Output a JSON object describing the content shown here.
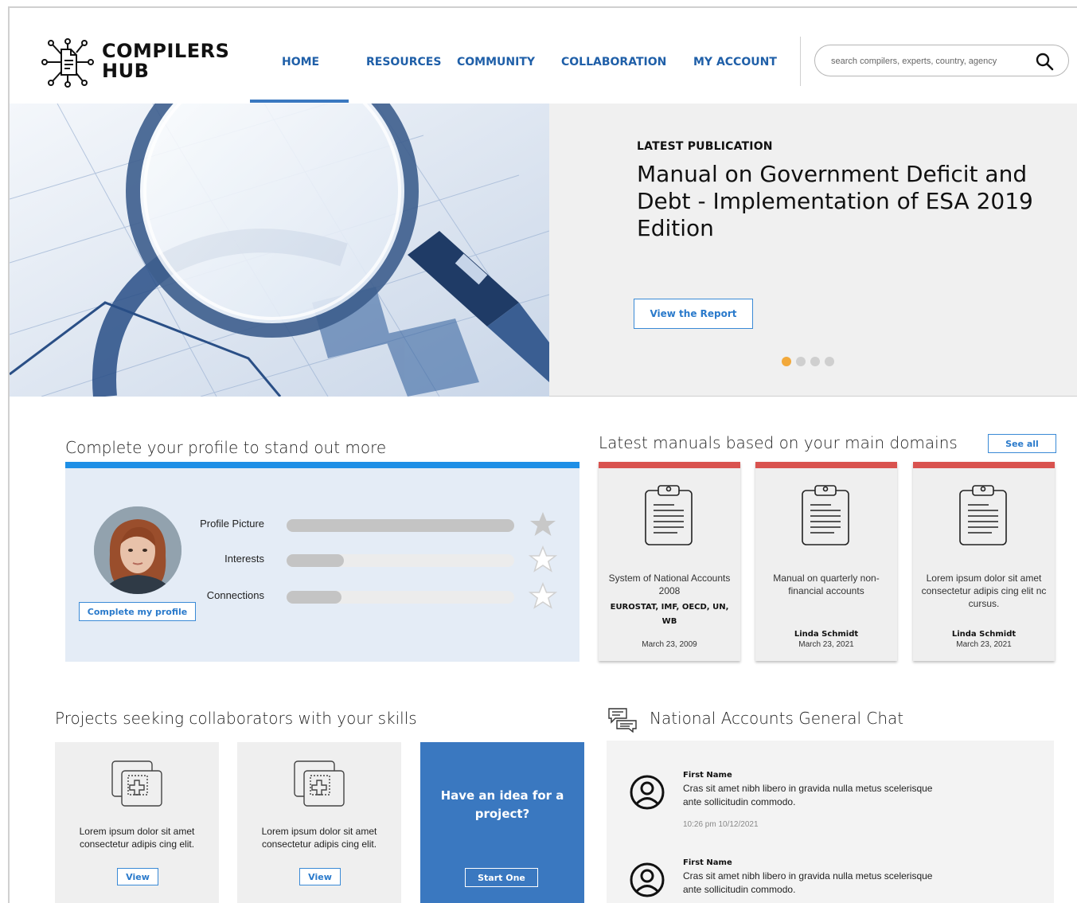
{
  "brand": {
    "line1": "COMPILERS",
    "line2": "HUB"
  },
  "nav": {
    "items": [
      {
        "label": "HOME"
      },
      {
        "label": "RESOURCES"
      },
      {
        "label": "COMMUNITY"
      },
      {
        "label": "COLLABORATION"
      },
      {
        "label": "MY ACCOUNT"
      }
    ],
    "active": "HOME"
  },
  "search": {
    "placeholder": "search compilers, experts, country, agency",
    "value": ""
  },
  "hero": {
    "eyebrow": "LATEST PUBLICATION",
    "title": "Manual on Government Deficit and Debt - Implementation of ESA 2019 Edition",
    "button": "View the Report",
    "slides_total": 4,
    "active_slide": 1
  },
  "profile": {
    "title": "Complete your profile to stand out more",
    "button": "Complete my profile",
    "items": [
      {
        "label": "Profile Picture",
        "progress_pct": 100,
        "starred": true
      },
      {
        "label": "Interests",
        "progress_pct": 25,
        "starred": false
      },
      {
        "label": "Connections",
        "progress_pct": 24,
        "starred": false
      }
    ]
  },
  "manuals": {
    "title": "Latest manuals based on your main domains",
    "see_all": "See all",
    "cards": [
      {
        "title": "System of National Accounts 2008",
        "author": "EUROSTAT, IMF, OECD, UN, WB",
        "date": "March 23, 2009"
      },
      {
        "title": "Manual on quarterly non-financial accounts",
        "author": "Linda Schmidt",
        "date": "March 23, 2021"
      },
      {
        "title": "Lorem ipsum dolor sit amet consectetur adipis cing elit nc cursus.",
        "author": "Linda Schmidt",
        "date": "March 23, 2021"
      }
    ]
  },
  "projects": {
    "title": "Projects seeking collaborators with your skills",
    "cards": [
      {
        "text": "Lorem ipsum dolor sit amet consectetur adipis cing elit.",
        "button": "View"
      },
      {
        "text": "Lorem ipsum dolor sit amet consectetur adipis cing elit.",
        "button": "View"
      }
    ],
    "idea": {
      "text": "Have an idea for a project?",
      "button": "Start One"
    }
  },
  "chat": {
    "title": "National Accounts General Chat",
    "messages": [
      {
        "name": "First Name",
        "text": "Cras sit amet nibh libero in gravida nulla metus scelerisque ante sollicitudin commodo.",
        "time": "10:26 pm 10/12/2021"
      },
      {
        "name": "First Name",
        "text": "Cras sit amet nibh libero in gravida nulla metus scelerisque ante sollicitudin commodo.",
        "time": ""
      }
    ]
  },
  "colors": {
    "nav_blue": "#1f5fa8",
    "accent_blue": "#3a78c0",
    "profile_bar": "#1e8fe6",
    "manual_bar": "#d9534f",
    "dot_active": "#f2a93b"
  },
  "icons": {
    "logo": "document-network-icon",
    "search": "search-icon",
    "star": "star-icon",
    "manual": "clipboard-icon",
    "project": "add-copy-icon",
    "chat": "chat-bubbles-icon",
    "user": "user-circle-icon"
  }
}
